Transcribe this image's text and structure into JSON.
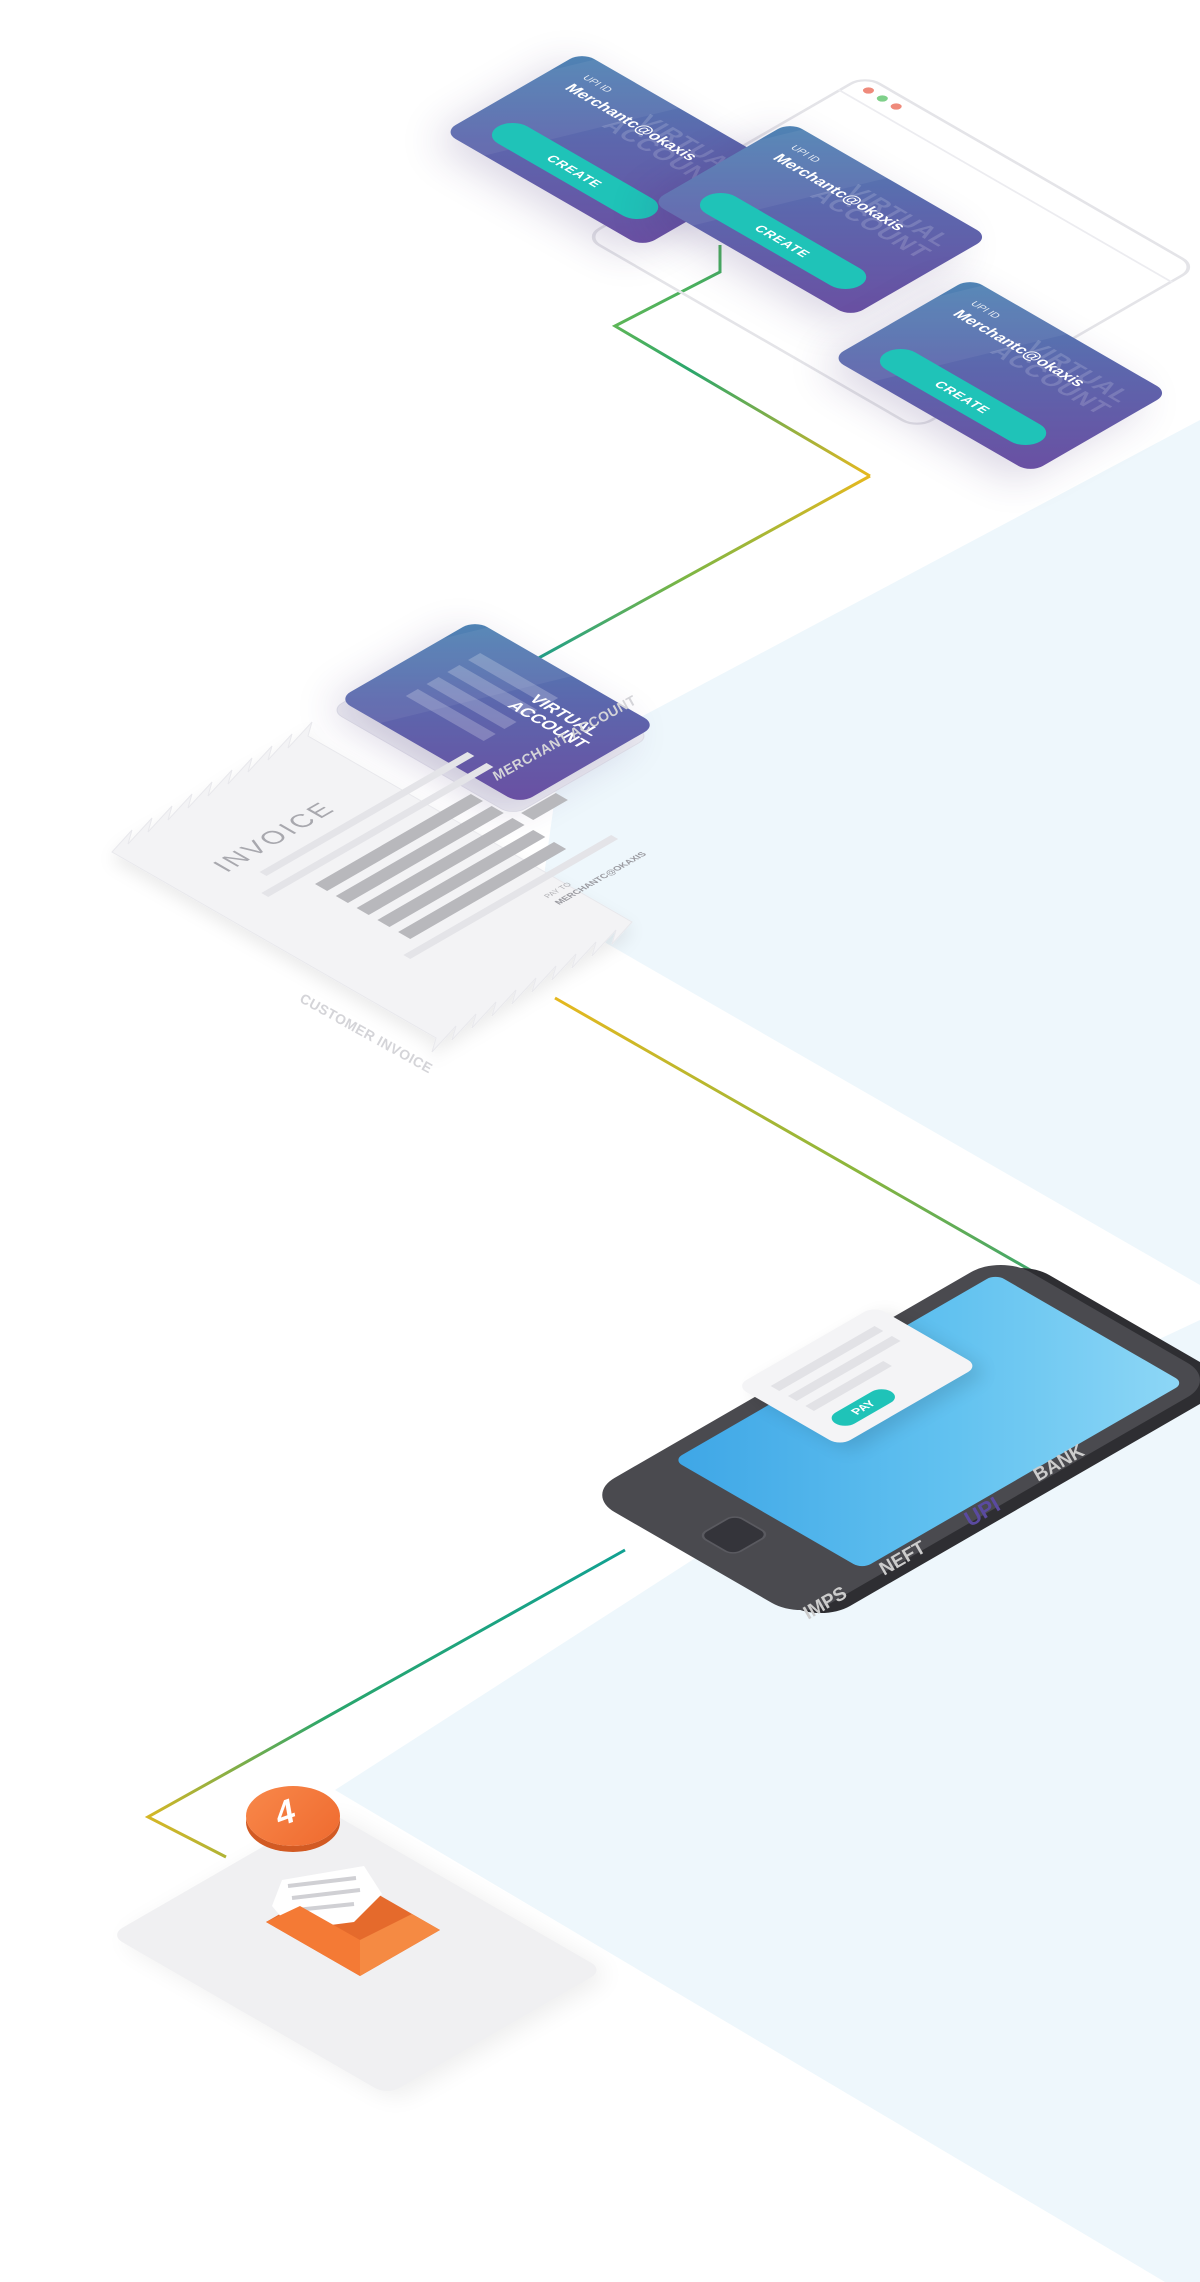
{
  "upi_cards": [
    {
      "upi_label": "UPI ID",
      "upi_value": "Merchantc@okaxis",
      "button_label": "CREATE",
      "watermark": "VIRTUAL\nACCOUNT"
    },
    {
      "upi_label": "UPI ID",
      "upi_value": "Merchantc@okaxis",
      "button_label": "CREATE",
      "watermark": "VIRTUAL\nACCOUNT"
    },
    {
      "upi_label": "UPI ID",
      "upi_value": "Merchantc@okaxis",
      "button_label": "CREATE",
      "watermark": "VIRTUAL\nACCOUNT"
    }
  ],
  "virtual_account": {
    "title": "VIRTUAL ACCOUNT",
    "caption": "MERCHANT ACCOUNT"
  },
  "invoice": {
    "heading": "INVOICE",
    "pay_to_label": "PAY TO",
    "pay_to_value": "MERCHANTC@OKAXIS",
    "caption": "CUSTOMER INVOICE"
  },
  "phone": {
    "pay_button": "PAY"
  },
  "payment_methods": [
    {
      "label": "IMPS",
      "active": false
    },
    {
      "label": "NEFT",
      "active": false
    },
    {
      "label": "UPI",
      "active": true
    },
    {
      "label": "BANK",
      "active": false
    }
  ],
  "notification": {
    "badge": "4"
  },
  "colors": {
    "card_start": "#4e84b4",
    "card_end": "#6a4fa2",
    "button_teal": "#1fc3b8",
    "line_green": "#2fa36b",
    "line_yellow": "#dcb320",
    "orange": "#f47a35",
    "background_band": "#eef7fc",
    "active_method": "#5a4aa0",
    "inactive_method": "#cccccc"
  },
  "icons": [
    "envelope-icon",
    "document-icon",
    "phone-device-icon"
  ]
}
